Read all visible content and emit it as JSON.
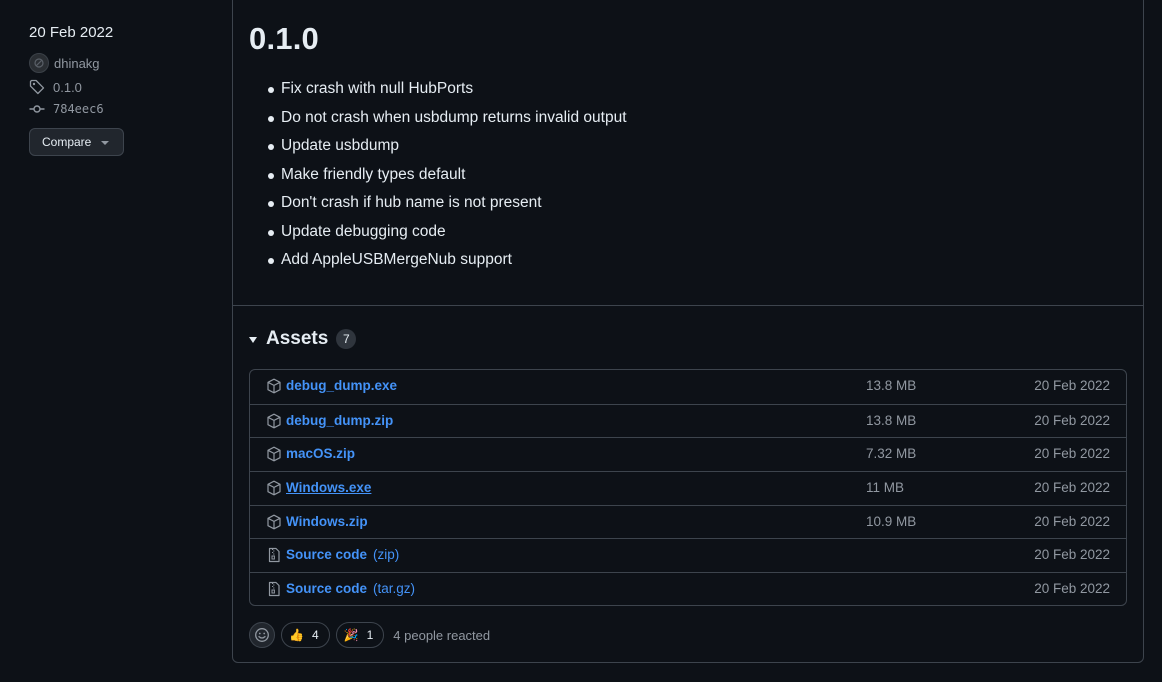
{
  "release": {
    "date": "20 Feb 2022",
    "author": "dhinakg",
    "tag": "0.1.0",
    "commit": "784eec6",
    "compare_label": "Compare",
    "title": "0.1.0",
    "notes": [
      "Fix crash with null HubPorts",
      "Do not crash when usbdump returns invalid output",
      "Update usbdump",
      "Make friendly types default",
      "Don't crash if hub name is not present",
      "Update debugging code",
      "Add AppleUSBMergeNub support"
    ]
  },
  "assets": {
    "heading": "Assets",
    "count": "7",
    "items": [
      {
        "name": "debug_dump.exe",
        "suffix": "",
        "size": "13.8 MB",
        "date": "20 Feb 2022",
        "icon": "package-icon"
      },
      {
        "name": "debug_dump.zip",
        "suffix": "",
        "size": "13.8 MB",
        "date": "20 Feb 2022",
        "icon": "package-icon"
      },
      {
        "name": "macOS.zip",
        "suffix": "",
        "size": "7.32 MB",
        "date": "20 Feb 2022",
        "icon": "package-icon"
      },
      {
        "name": "Windows.exe",
        "suffix": "",
        "size": "11 MB",
        "date": "20 Feb 2022",
        "icon": "package-icon"
      },
      {
        "name": "Windows.zip",
        "suffix": "",
        "size": "10.9 MB",
        "date": "20 Feb 2022",
        "icon": "package-icon"
      },
      {
        "name": "Source code",
        "suffix": "(zip)",
        "size": "",
        "date": "20 Feb 2022",
        "icon": "file-zip-icon"
      },
      {
        "name": "Source code",
        "suffix": "(tar.gz)",
        "size": "",
        "date": "20 Feb 2022",
        "icon": "file-zip-icon"
      }
    ]
  },
  "reactions": {
    "thumbs_up": {
      "emoji": "👍",
      "count": "4"
    },
    "tada": {
      "emoji": "🎉",
      "count": "1"
    },
    "summary": "4 people reacted"
  },
  "colors": {
    "background": "#0d1117",
    "border": "#3d444d",
    "link": "#4493f8",
    "muted": "#9198a1",
    "text": "#e6edf3"
  }
}
